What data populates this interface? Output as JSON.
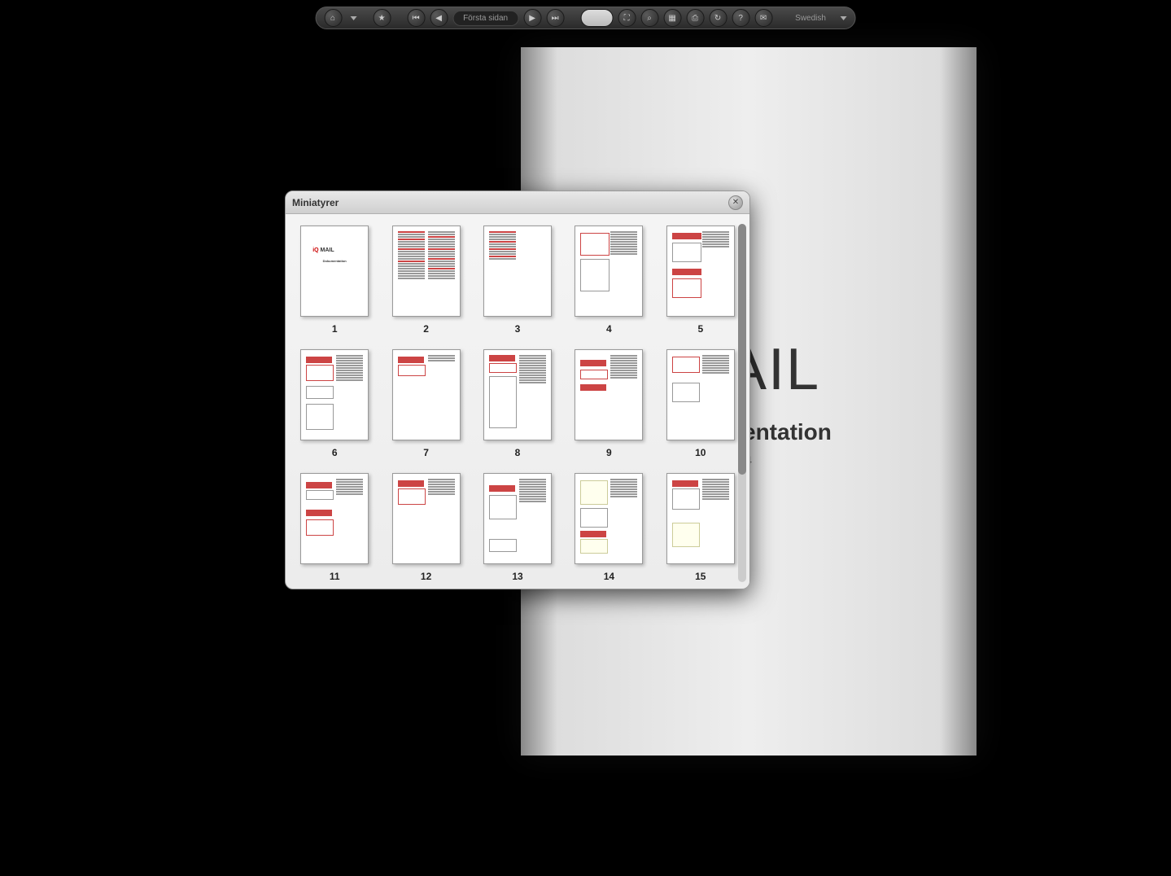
{
  "toolbar": {
    "page_label": "Första sidan",
    "language": "Swedish"
  },
  "document": {
    "title": "MAIL",
    "subtitle": "Dokumentation",
    "meta": "4"
  },
  "panel": {
    "title": "Miniatyrer",
    "close": "✕"
  },
  "thumbs": {
    "t1": "1",
    "t2": "2",
    "t3": "3",
    "t4": "4",
    "t5": "5",
    "t6": "6",
    "t7": "7",
    "t8": "8",
    "t9": "9",
    "t10": "10",
    "t11": "11",
    "t12": "12",
    "t13": "13",
    "t14": "14",
    "t15": "15"
  },
  "cover": {
    "logo_iq": "iQ",
    "logo_mail": " MAIL",
    "sub": "Dokumentation"
  }
}
